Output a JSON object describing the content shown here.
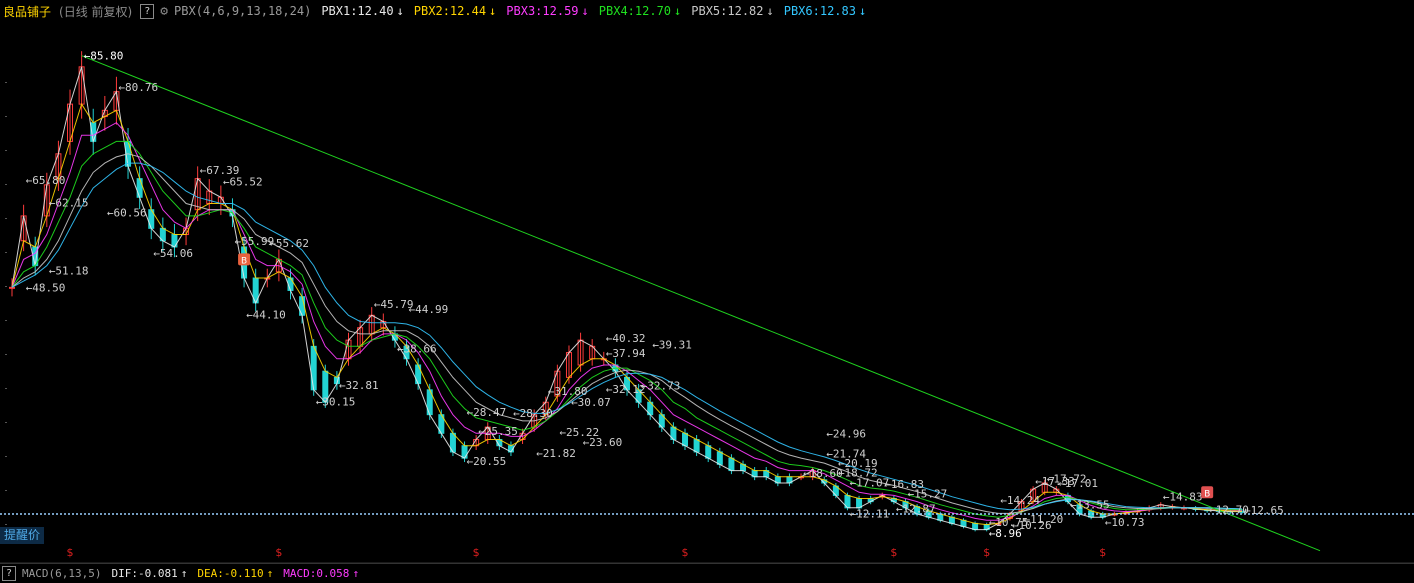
{
  "header": {
    "stock_name": "良品铺子",
    "period": "(日线 前复权)",
    "help": "?",
    "indicator_name": "PBX(4,6,9,13,18,24)",
    "indicators": [
      {
        "label": "PBX1:12.40",
        "arrow": "↓",
        "color": "#e8e8e8"
      },
      {
        "label": "PBX2:12.44",
        "arrow": "↓",
        "color": "#ffd400"
      },
      {
        "label": "PBX3:12.59",
        "arrow": "↓",
        "color": "#ff3cff"
      },
      {
        "label": "PBX4:12.70",
        "arrow": "↓",
        "color": "#1fe01f"
      },
      {
        "label": "PBX5:12.82",
        "arrow": "↓",
        "color": "#c8c8c8"
      },
      {
        "label": "PBX6:12.83",
        "arrow": "↓",
        "color": "#33c7ff"
      }
    ]
  },
  "chart_data": {
    "type": "candlestick",
    "title": "良品铺子",
    "price_range": [
      7.5,
      88
    ],
    "price_labels": [
      {
        "value": 85.8,
        "idx": 6,
        "text": "85.80",
        "color": "#ffffff"
      },
      {
        "value": 80.76,
        "idx": 9,
        "text": "80.76"
      },
      {
        "value": 65.8,
        "idx": 1,
        "text": "65.80"
      },
      {
        "value": 62.15,
        "idx": 3,
        "text": "62.15"
      },
      {
        "value": 60.56,
        "idx": 8,
        "text": "60.56"
      },
      {
        "value": 51.18,
        "idx": 3,
        "text": "51.18"
      },
      {
        "value": 48.5,
        "idx": 1,
        "text": "48.50"
      },
      {
        "value": 67.39,
        "idx": 16,
        "text": "67.39"
      },
      {
        "value": 65.52,
        "idx": 18,
        "text": "65.52"
      },
      {
        "value": 54.06,
        "idx": 12,
        "text": "54.06"
      },
      {
        "value": 55.62,
        "idx": 22,
        "text": "55.62"
      },
      {
        "value": 55.99,
        "idx": 19,
        "text": "55.99"
      },
      {
        "value": 44.1,
        "idx": 20,
        "text": "44.10"
      },
      {
        "value": 45.79,
        "idx": 31,
        "text": "45.79"
      },
      {
        "value": 44.99,
        "idx": 34,
        "text": "44.99"
      },
      {
        "value": 38.66,
        "idx": 33,
        "text": "38.66"
      },
      {
        "value": 32.81,
        "idx": 28,
        "text": "32.81"
      },
      {
        "value": 30.15,
        "idx": 26,
        "text": "30.15"
      },
      {
        "value": 28.47,
        "idx": 39,
        "text": "28.47"
      },
      {
        "value": 28.3,
        "idx": 43,
        "text": "28.30"
      },
      {
        "value": 25.35,
        "idx": 40,
        "text": "25.35"
      },
      {
        "value": 20.55,
        "idx": 39,
        "text": "20.55"
      },
      {
        "value": 21.82,
        "idx": 45,
        "text": "21.82"
      },
      {
        "value": 31.8,
        "idx": 46,
        "text": "31.80"
      },
      {
        "value": 30.07,
        "idx": 48,
        "text": "30.07"
      },
      {
        "value": 23.6,
        "idx": 49,
        "text": "23.60"
      },
      {
        "value": 25.22,
        "idx": 47,
        "text": "25.22"
      },
      {
        "value": 40.32,
        "idx": 51,
        "text": "40.32"
      },
      {
        "value": 37.94,
        "idx": 51,
        "text": "37.94"
      },
      {
        "value": 39.31,
        "idx": 55,
        "text": "39.31"
      },
      {
        "value": 32.12,
        "idx": 51,
        "text": "32.12"
      },
      {
        "value": 32.73,
        "idx": 54,
        "text": "32.73"
      },
      {
        "value": 24.96,
        "idx": 70,
        "text": "24.96"
      },
      {
        "value": 21.74,
        "idx": 70,
        "text": "21.74"
      },
      {
        "value": 20.19,
        "idx": 71,
        "text": "20.19"
      },
      {
        "value": 18.72,
        "idx": 71,
        "text": "18.72"
      },
      {
        "value": 18.6,
        "idx": 68,
        "text": "18.60"
      },
      {
        "value": 17.07,
        "idx": 72,
        "text": "17.07"
      },
      {
        "value": 16.83,
        "idx": 75,
        "text": "16.83"
      },
      {
        "value": 15.27,
        "idx": 77,
        "text": "15.27"
      },
      {
        "value": 12.11,
        "idx": 72,
        "text": "12.11"
      },
      {
        "value": 12.87,
        "idx": 76,
        "text": "12.87"
      },
      {
        "value": 14.24,
        "idx": 85,
        "text": "14.24"
      },
      {
        "value": 17.33,
        "idx": 88,
        "text": "17.33"
      },
      {
        "value": 17.72,
        "idx": 89,
        "text": "17.72"
      },
      {
        "value": 17.01,
        "idx": 90,
        "text": "17.01"
      },
      {
        "value": 10.75,
        "idx": 84,
        "text": "10.75"
      },
      {
        "value": 11.2,
        "idx": 87,
        "text": "11.20"
      },
      {
        "value": 10.26,
        "idx": 86,
        "text": "10.26"
      },
      {
        "value": 8.96,
        "idx": 84,
        "text": "8.96",
        "color": "#ffffff"
      },
      {
        "value": 13.55,
        "idx": 91,
        "text": "13.55"
      },
      {
        "value": 10.73,
        "idx": 94,
        "text": "10.73"
      },
      {
        "value": 14.83,
        "idx": 99,
        "text": "14.83"
      },
      {
        "value": 12.7,
        "idx": 103,
        "text": "12.70"
      },
      {
        "value": 12.65,
        "idx": 106,
        "text": "12.65"
      }
    ],
    "series": [
      {
        "name": "PBX1",
        "values": [
          48.5,
          60,
          52,
          65,
          70,
          78,
          84,
          72,
          77,
          80,
          68,
          63,
          58,
          56,
          55,
          58,
          66,
          64,
          63,
          60,
          50,
          46,
          50,
          53,
          48,
          44,
          32,
          30,
          33,
          40,
          42,
          44,
          43,
          40,
          37,
          33,
          28,
          25,
          22,
          21,
          24,
          26,
          23,
          22,
          25,
          28,
          30,
          35,
          38,
          40,
          39,
          37,
          35,
          32,
          30,
          28,
          26,
          24,
          23,
          22,
          21,
          20,
          19,
          19,
          18,
          18,
          17,
          17,
          18,
          19,
          17,
          15,
          13,
          13,
          14,
          15,
          14,
          13,
          12,
          11.5,
          11,
          10.5,
          10,
          9.5,
          9.5,
          10.5,
          12,
          14,
          16,
          17,
          16,
          14,
          12,
          11.5,
          11.5,
          12,
          12.2,
          12.5,
          13,
          13.5,
          13.2,
          13,
          12.8,
          12.6,
          12.5,
          12.4,
          12.4
        ]
      },
      {
        "name": "PBX2",
        "values": [
          48.5,
          56,
          55,
          60,
          66,
          72,
          78,
          75,
          76,
          77,
          72,
          66,
          61,
          58,
          57,
          57,
          61,
          62,
          62,
          61,
          55,
          50,
          50,
          51,
          50,
          47,
          39,
          35,
          34,
          37,
          39,
          41,
          42,
          41,
          39,
          36,
          32,
          28,
          25,
          23,
          23,
          24,
          24,
          23,
          24,
          26,
          28,
          31,
          34,
          36,
          37,
          37,
          36,
          34,
          32,
          30,
          28,
          26,
          25,
          24,
          23,
          22,
          21,
          20,
          19,
          19,
          18,
          18,
          18,
          18,
          17.5,
          16.5,
          15,
          14.5,
          14.5,
          14.8,
          14.5,
          14,
          13.2,
          12.5,
          12,
          11.5,
          11,
          10.5,
          10.3,
          10.5,
          11.3,
          12.5,
          14,
          15.5,
          15.5,
          15,
          13.5,
          12.5,
          12,
          12,
          12.2,
          12.4,
          12.7,
          13,
          13.1,
          13,
          12.9,
          12.7,
          12.6,
          12.5,
          12.44
        ]
      },
      {
        "name": "PBX3",
        "values": [
          48.5,
          53,
          54,
          57,
          62,
          67,
          73,
          73,
          74,
          75,
          73,
          69,
          65,
          61,
          59,
          58,
          60,
          61,
          61,
          61,
          57,
          53,
          52,
          52,
          51,
          49,
          43,
          39,
          37,
          37,
          38,
          40,
          41,
          41,
          40,
          38,
          35,
          31,
          28,
          26,
          25,
          25,
          25,
          24.5,
          24.5,
          25.5,
          27,
          29,
          32,
          34,
          35.5,
          36,
          36,
          35,
          33.5,
          32,
          30,
          28,
          27,
          26,
          25,
          24,
          23,
          22,
          21,
          20.5,
          19.5,
          19,
          19,
          19,
          18.5,
          17.5,
          16.5,
          15.5,
          15.2,
          15.2,
          15,
          14.5,
          14,
          13.3,
          12.7,
          12.2,
          11.8,
          11.3,
          11,
          11,
          11.5,
          12.3,
          13.3,
          14.5,
          15,
          15,
          14.2,
          13.4,
          12.8,
          12.5,
          12.4,
          12.5,
          12.7,
          12.9,
          13,
          13,
          13,
          12.9,
          12.8,
          12.7,
          12.59
        ]
      },
      {
        "name": "PBX4",
        "values": [
          48.5,
          51,
          52,
          55,
          59,
          63,
          68,
          70,
          71,
          72,
          72,
          70,
          67,
          64,
          62,
          60,
          60,
          60.5,
          61,
          60.5,
          58,
          55,
          54,
          53,
          52,
          50.5,
          46,
          42,
          40,
          39,
          39,
          40,
          40.5,
          41,
          40.5,
          39,
          37,
          34,
          31,
          29,
          27.5,
          27,
          26.5,
          26,
          25.5,
          26,
          27,
          28.5,
          30.5,
          32.5,
          34,
          35,
          35.5,
          35.5,
          34.5,
          33.5,
          32,
          30,
          29,
          27.5,
          26.5,
          25.5,
          24.5,
          23.5,
          22.5,
          21.5,
          20.5,
          20,
          19.8,
          19.5,
          19,
          18.3,
          17.5,
          16.6,
          16.2,
          16,
          15.7,
          15.2,
          14.7,
          14.1,
          13.5,
          13,
          12.5,
          12,
          11.7,
          11.5,
          11.8,
          12.3,
          13,
          14,
          14.5,
          14.7,
          14.3,
          13.8,
          13.3,
          12.9,
          12.7,
          12.7,
          12.8,
          12.9,
          13,
          13,
          13,
          12.95,
          12.85,
          12.75,
          12.7
        ]
      },
      {
        "name": "PBX5",
        "values": [
          48.5,
          50,
          51,
          53,
          56,
          60,
          64,
          67,
          68.5,
          69.5,
          70,
          69.5,
          68,
          66,
          64,
          62,
          61.5,
          61,
          61,
          61,
          59.5,
          57,
          56,
          55,
          54,
          52.5,
          49,
          45.5,
          43,
          41.5,
          41,
          41,
          41.5,
          41.5,
          41.5,
          40.5,
          39,
          36.5,
          34,
          32,
          30,
          29,
          28,
          27.5,
          27,
          27,
          27.5,
          28.5,
          30,
          31.5,
          33,
          34,
          34.8,
          35.2,
          35,
          34.5,
          33.5,
          32,
          30.8,
          29.5,
          28.3,
          27.2,
          26.2,
          25.2,
          24.2,
          23.2,
          22.2,
          21.5,
          21,
          20.6,
          20.2,
          19.5,
          18.8,
          18,
          17.4,
          17,
          16.6,
          16.1,
          15.6,
          15,
          14.4,
          13.8,
          13.3,
          12.8,
          12.4,
          12.1,
          12.1,
          12.4,
          12.9,
          13.6,
          14.1,
          14.4,
          14.3,
          14,
          13.6,
          13.2,
          13,
          12.9,
          12.9,
          12.95,
          13,
          13,
          13,
          13,
          12.95,
          12.9,
          12.82
        ]
      },
      {
        "name": "PBX6",
        "values": [
          48.5,
          49.5,
          50.5,
          52,
          54.5,
          58,
          61.5,
          64.5,
          66,
          67.5,
          68.5,
          68.5,
          68,
          67,
          65.5,
          64,
          63,
          62.5,
          62,
          62,
          61,
          59,
          58,
          57,
          56,
          54.5,
          52,
          48.5,
          46,
          44,
          43,
          42.8,
          42.8,
          42.8,
          42.6,
          42,
          40.8,
          38.8,
          36.5,
          34.5,
          32.5,
          31.2,
          30,
          29.2,
          28.5,
          28.2,
          28.2,
          28.8,
          29.8,
          31,
          32.2,
          33.2,
          34,
          34.6,
          34.7,
          34.5,
          34,
          33,
          32,
          30.8,
          29.7,
          28.6,
          27.6,
          26.6,
          25.6,
          24.6,
          23.6,
          22.8,
          22.2,
          21.7,
          21.2,
          20.6,
          19.9,
          19.2,
          18.6,
          18.1,
          17.6,
          17.1,
          16.6,
          16,
          15.4,
          14.8,
          14.3,
          13.8,
          13.3,
          12.9,
          12.7,
          12.8,
          13.1,
          13.6,
          14,
          14.3,
          14.3,
          14.1,
          13.8,
          13.5,
          13.2,
          13.1,
          13,
          13,
          13,
          13,
          13,
          13,
          12.95,
          12.9,
          12.83
        ]
      }
    ],
    "trendline": {
      "from": {
        "idx": 6,
        "value": 85.8
      },
      "to": {
        "idx": 111,
        "value": 9.0
      },
      "color": "#1fd21f"
    },
    "alert_price": 12.0,
    "markers": [
      {
        "idx": 20,
        "value": 53,
        "text": "B",
        "color": "#e8603c"
      },
      {
        "idx": 103,
        "value": 15.5,
        "text": "B",
        "color": "#e05050"
      }
    ],
    "signals_s": [
      5,
      23,
      40,
      58,
      76,
      84,
      94
    ],
    "x_count": 112,
    "grid": false,
    "legend": "top-left"
  },
  "alert_label": "提醒价",
  "sub": {
    "help": "?",
    "name": "MACD(6,13,5)",
    "values": [
      {
        "label": "DIF:-0.081",
        "arrow": "↑",
        "color": "#e8e8e8"
      },
      {
        "label": "DEA:-0.110",
        "arrow": "↑",
        "color": "#ffd400"
      },
      {
        "label": "MACD:0.058",
        "arrow": "↑",
        "color": "#ff3cff"
      }
    ]
  }
}
